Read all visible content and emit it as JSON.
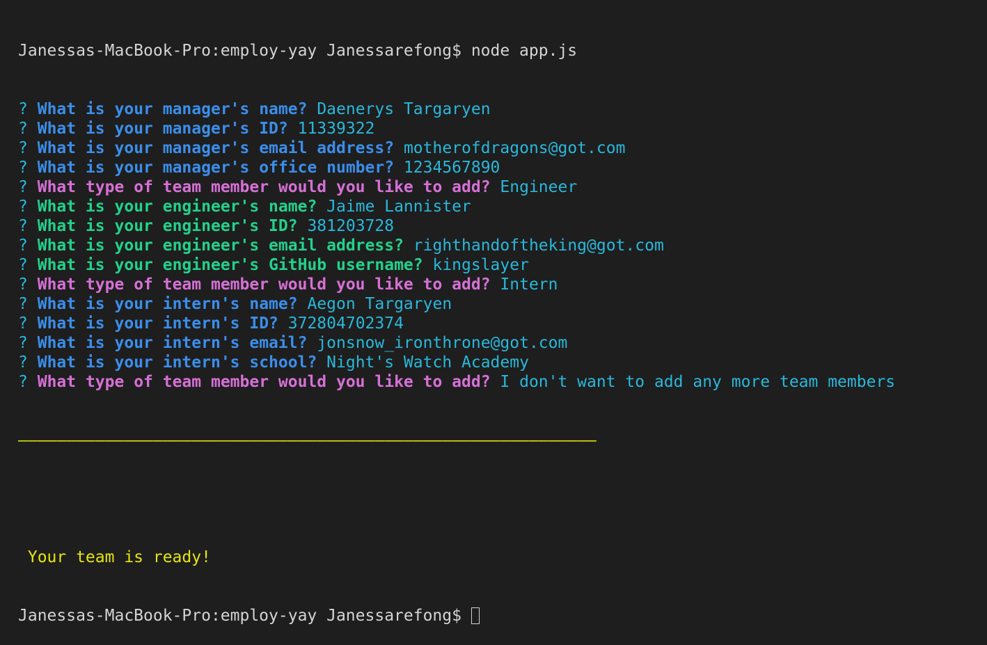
{
  "colors": {
    "background": "#1e1e1e",
    "default_text": "#d4d4d4",
    "manager_question": "#3b8eea",
    "type_question": "#d670d6",
    "engineer_question": "#23d18b",
    "intern_question": "#3b8eea",
    "answer": "#29b8db",
    "yellow": "#e5e510"
  },
  "prompt": {
    "top": "Janessas-MacBook-Pro:employ-yay Janessarefong$ node app.js",
    "bottom": "Janessas-MacBook-Pro:employ-yay Janessarefong$ "
  },
  "qa": [
    {
      "q": "What is your manager's name?",
      "a": "Daenerys Targaryen",
      "color": "#3b8eea"
    },
    {
      "q": "What is your manager's ID?",
      "a": "11339322",
      "color": "#3b8eea"
    },
    {
      "q": "What is your manager's email address?",
      "a": "motherofdragons@got.com",
      "color": "#3b8eea"
    },
    {
      "q": "What is your manager's office number?",
      "a": "1234567890",
      "color": "#3b8eea"
    },
    {
      "q": "What type of team member would you like to add?",
      "a": "Engineer",
      "color": "#d670d6"
    },
    {
      "q": "What is your engineer's name?",
      "a": "Jaime Lannister",
      "color": "#23d18b"
    },
    {
      "q": "What is your engineer's ID?",
      "a": "381203728",
      "color": "#23d18b"
    },
    {
      "q": "What is your engineer's email address?",
      "a": "righthandoftheking@got.com",
      "color": "#23d18b"
    },
    {
      "q": "What is your engineer's GitHub username?",
      "a": "kingslayer",
      "color": "#23d18b"
    },
    {
      "q": "What type of team member would you like to add?",
      "a": "Intern",
      "color": "#d670d6"
    },
    {
      "q": "What is your intern's name?",
      "a": "Aegon Targaryen",
      "color": "#3b8eea"
    },
    {
      "q": "What is your intern's ID?",
      "a": "372804702374",
      "color": "#3b8eea"
    },
    {
      "q": "What is your intern's email?",
      "a": "jonsnow_ironthrone@got.com",
      "color": "#3b8eea"
    },
    {
      "q": "What is your intern's school?",
      "a": "Night's Watch Academy",
      "color": "#3b8eea"
    },
    {
      "q": "What type of team member would you like to add?",
      "a": "I don't want to add any more team members",
      "color": "#d670d6"
    }
  ],
  "question_mark": "?",
  "divider": "————————————————————————————————————————————————————————————",
  "ready_message": " Your team is ready!"
}
